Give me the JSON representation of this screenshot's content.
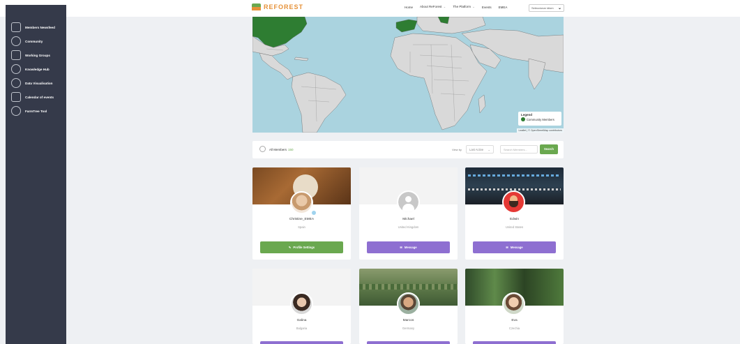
{
  "header": {
    "logo_text": "REFOREST",
    "nav": [
      "Home",
      "About ReForest",
      "The Platform",
      "Events",
      "EMEA"
    ],
    "language_select": "Seleccionar idiom"
  },
  "sidebar": {
    "items": [
      {
        "label": "Members Newsfeed",
        "icon": "newsfeed-icon"
      },
      {
        "label": "Community",
        "icon": "community-icon"
      },
      {
        "label": "Working Groups",
        "icon": "groups-icon"
      },
      {
        "label": "Knowledge Hub",
        "icon": "knowledge-icon"
      },
      {
        "label": "Data Visualisation",
        "icon": "data-visualisation-icon"
      },
      {
        "label": "Calendar of events",
        "icon": "calendar-icon"
      },
      {
        "label": "FarmTree Tool",
        "icon": "farmtree-icon"
      }
    ]
  },
  "map": {
    "legend_title": "Legend",
    "legend_item": "Community Members",
    "attribution": "Leaflet | © OpenStreetMap contributors",
    "member_color": "#2e7d32",
    "water_color": "#aad3df"
  },
  "filters": {
    "all_members_label": "All Members",
    "all_members_count": "150",
    "view_by_label": "View by",
    "sort_value": "Last Active",
    "search_placeholder": "Search Members...",
    "search_button": "Search"
  },
  "members": [
    {
      "name": "Christine_EMEA",
      "country": "Spain",
      "button": "Profile Settings",
      "button_type": "profile"
    },
    {
      "name": "Michael",
      "country": "United Kingdom",
      "button": "Message",
      "button_type": "message"
    },
    {
      "name": "Edwin",
      "country": "United States",
      "button": "Message",
      "button_type": "message"
    },
    {
      "name": "Galina",
      "country": "Bulgaria"
    },
    {
      "name": "Marcos",
      "country": "Germany"
    },
    {
      "name": "Eva",
      "country": "Czechia"
    }
  ]
}
